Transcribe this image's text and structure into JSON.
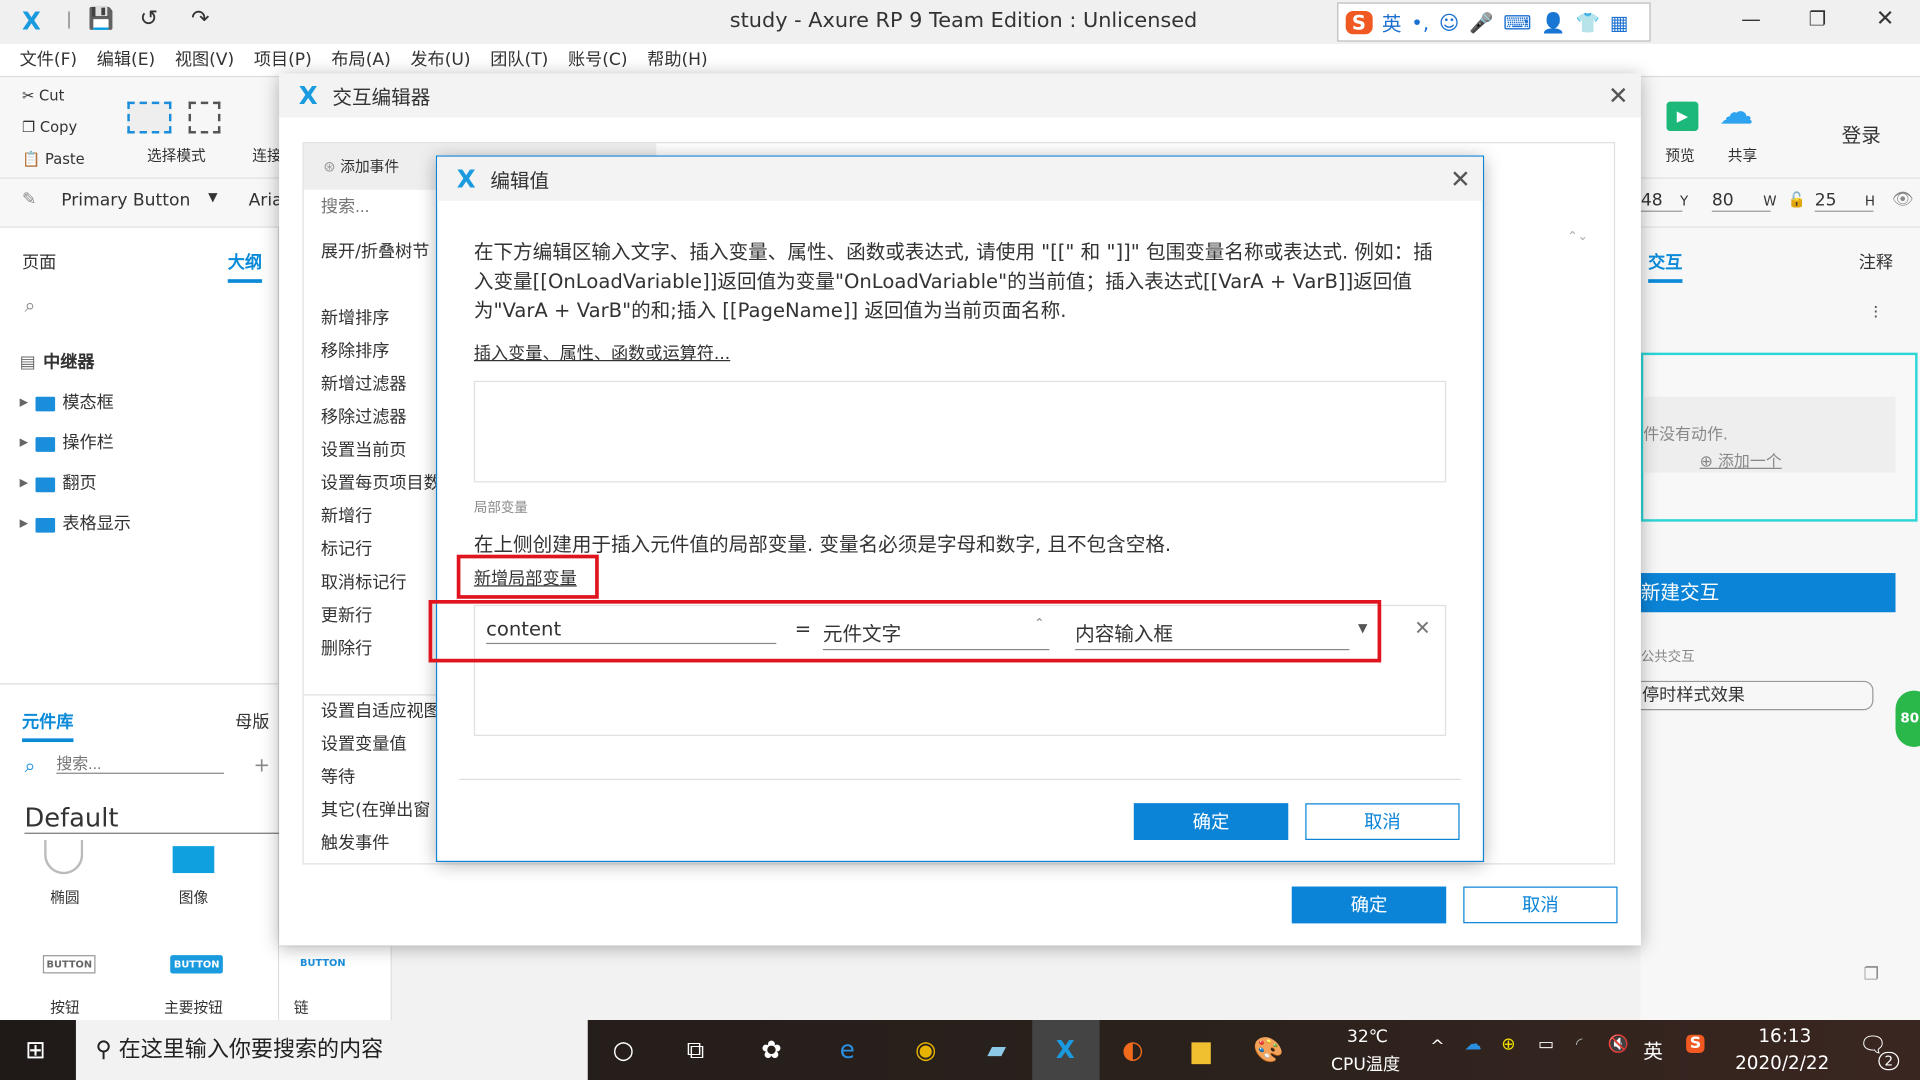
{
  "window": {
    "title": "study - Axure RP 9 Team Edition : Unlicensed"
  },
  "menu": [
    "文件(F)",
    "编辑(E)",
    "视图(V)",
    "项目(P)",
    "布局(A)",
    "发布(U)",
    "团队(T)",
    "账号(C)",
    "帮助(H)"
  ],
  "toolbar": {
    "cut": "Cut",
    "copy": "Copy",
    "paste": "Paste",
    "select_mode": "选择模式",
    "connect": "连接",
    "preview": "预览",
    "share": "共享",
    "login": "登录"
  },
  "stylebar": {
    "style": "Primary Button",
    "font": "Aria",
    "x": "48",
    "y_label": "Y",
    "y": "80",
    "w_label": "W",
    "w": "25",
    "h_label": "H"
  },
  "left": {
    "tabs": [
      "页面",
      "大纲"
    ],
    "tree_root": "中继器",
    "tree": [
      "模态框",
      "操作栏",
      "翻页",
      "表格显示"
    ],
    "lib_tabs": [
      "元件库",
      "母版"
    ],
    "search_placeholder": "搜索...",
    "library": "Default",
    "widgets": [
      "椭圆",
      "图像",
      "按钮",
      "主要按钮",
      "链接按钮"
    ],
    "button_text": "BUTTON"
  },
  "right": {
    "tabs": [
      "交互",
      "注释"
    ],
    "no_action": "件没有动作.",
    "add_one": "添加一个",
    "new_interaction": "新建交互",
    "common": "公共交互",
    "hover": "停时样式效果",
    "badge": "80"
  },
  "interaction_editor": {
    "title": "交互编辑器",
    "add_event": "添加事件",
    "search_placeholder": "搜索...",
    "actions": [
      "展开/折叠树节",
      "",
      "新增排序",
      "移除排序",
      "新增过滤器",
      "移除过滤器",
      "设置当前页",
      "设置每页项目数",
      "新增行",
      "标记行",
      "取消标记行",
      "更新行",
      "删除行",
      "",
      "设置自适应视图",
      "设置变量值",
      "等待",
      "其它(在弹出窗",
      "触发事件"
    ],
    "ok": "确定",
    "cancel": "取消"
  },
  "edit_value": {
    "title": "编辑值",
    "description": "在下方编辑区输入文字、插入变量、属性、函数或表达式, 请使用 \"[[\" 和 \"]]\" 包围变量名称或表达式. 例如：插入变量[[OnLoadVariable]]返回值为变量\"OnLoadVariable\"的当前值；插入表达式[[VarA + VarB]]返回值为\"VarA + VarB\"的和;插入 [[PageName]] 返回值为当前页面名称.",
    "insert_link": "插入变量、属性、函数或运算符...",
    "value": "",
    "local_vars_label": "局部变量",
    "local_vars_desc": "在上侧创建用于插入元件值的局部变量. 变量名必须是字母和数字, 且不包含空格.",
    "add_local_var": "新增局部变量",
    "var_row": {
      "name": "content",
      "equals": "=",
      "type": "元件文字",
      "target": "内容输入框"
    },
    "ok": "确定",
    "cancel": "取消",
    "highlight_color": "#e0141e"
  },
  "taskbar": {
    "search_placeholder": "在这里输入你要搜索的内容",
    "temp": "32℃",
    "temp_label": "CPU温度",
    "ime": "英",
    "time": "16:13",
    "date": "2020/2/22",
    "notifications": "2"
  }
}
